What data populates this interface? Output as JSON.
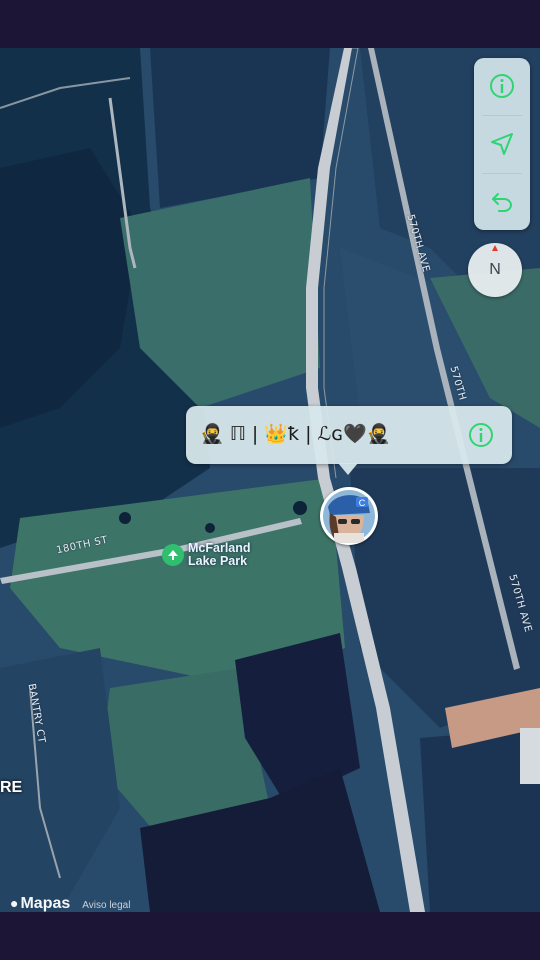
{
  "callout": {
    "name": "🥷 ℿ | 👑ꝁ | ℒɢ🖤🥷"
  },
  "poi": {
    "name_line1": "McFarland",
    "name_line2": "Lake Park",
    "icon": "park-tree-icon"
  },
  "roads": {
    "r180th": "180TH ST",
    "r570_a": "570TH AVE",
    "r570_b": "570TH",
    "r570_c": "570TH AVE",
    "bantry": "BANTRY CT"
  },
  "edge_text": "RE",
  "compass": {
    "label": "N"
  },
  "controls": {
    "info_icon": "info-icon",
    "location_icon": "location-arrow-icon",
    "back_icon": "return-arrow-icon"
  },
  "footer": {
    "logo": "Mapas",
    "legal": "Aviso legal"
  },
  "colors": {
    "accent": "#2ed573",
    "frame": "#1d1535",
    "compass_needle": "#e33b2e"
  }
}
